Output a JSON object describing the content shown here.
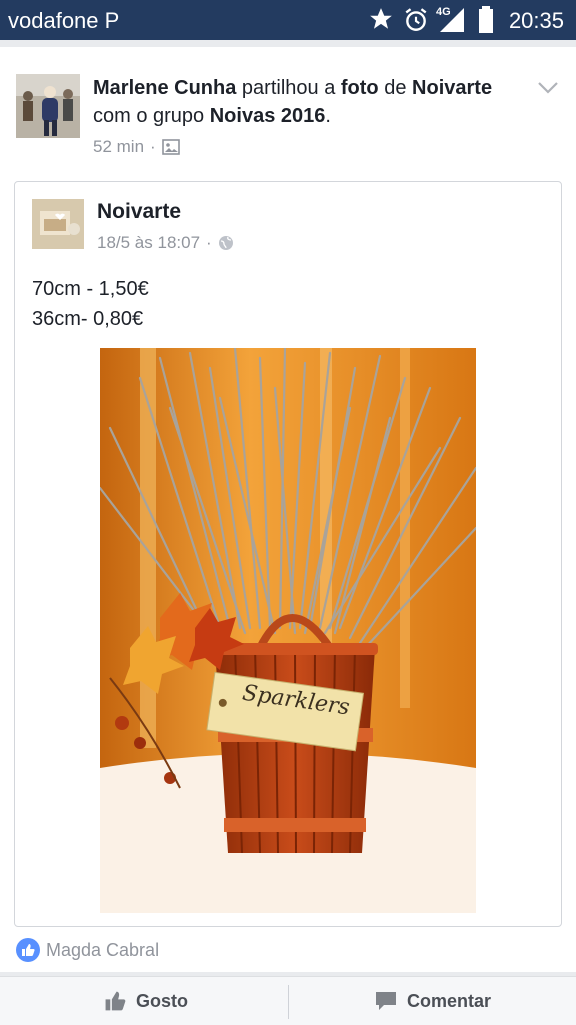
{
  "status_bar": {
    "carrier": "vodafone P",
    "network": "4G",
    "time": "20:35"
  },
  "share_header": {
    "actor": "Marlene Cunha",
    "verb": "partilhou a",
    "object": "foto",
    "preposition": "de",
    "source": "Noivarte",
    "group_prefix": "com o grupo",
    "group": "Noivas 2016",
    "end": ".",
    "time": "52 min",
    "separator": "·"
  },
  "post": {
    "page_name": "Noivarte",
    "date": "18/5 às 18:07",
    "separator": "·",
    "lines": [
      "70cm - 1,50€",
      "36cm- 0,80€"
    ],
    "photo_sign_text": "Sparklers"
  },
  "reactions": {
    "names": "Magda Cabral"
  },
  "actions": {
    "like": "Gosto",
    "comment": "Comentar"
  },
  "colors": {
    "status_bar": "#233b60",
    "like_blue": "#5890ff",
    "text_primary": "#1d2129",
    "text_secondary": "#90949c"
  },
  "icons": [
    "star-icon",
    "alarm-icon",
    "signal-icon",
    "battery-icon",
    "chevron-down-icon",
    "photo-icon",
    "globe-icon",
    "like-icon",
    "comment-icon"
  ]
}
